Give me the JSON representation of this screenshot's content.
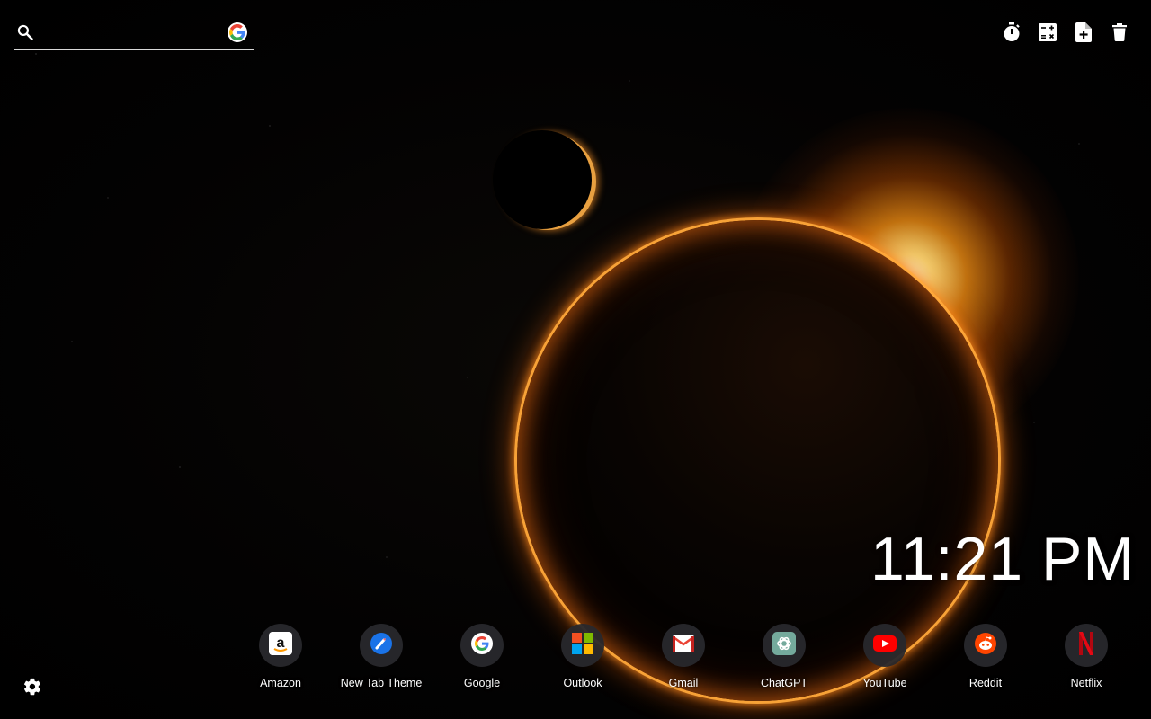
{
  "search": {
    "value": "",
    "placeholder": "",
    "engine_icon": "google-icon"
  },
  "toolbar": [
    {
      "icon": "stopwatch-icon"
    },
    {
      "icon": "calculator-icon"
    },
    {
      "icon": "add-note-icon"
    },
    {
      "icon": "trash-icon"
    }
  ],
  "clock": {
    "time": "11:21 PM"
  },
  "shortcuts": [
    {
      "label": "Amazon",
      "icon": "amazon-icon"
    },
    {
      "label": "New Tab Theme",
      "icon": "new-tab-theme-icon"
    },
    {
      "label": "Google",
      "icon": "google-icon"
    },
    {
      "label": "Outlook",
      "icon": "microsoft-icon"
    },
    {
      "label": "Gmail",
      "icon": "gmail-icon"
    },
    {
      "label": "ChatGPT",
      "icon": "chatgpt-icon"
    },
    {
      "label": "YouTube",
      "icon": "youtube-icon"
    },
    {
      "label": "Reddit",
      "icon": "reddit-icon"
    },
    {
      "label": "Netflix",
      "icon": "netflix-icon"
    }
  ],
  "settings": {
    "icon": "gear-icon"
  },
  "colors": {
    "amazon": "#ffffff",
    "new_tab_theme": "#1a73e8",
    "youtube": "#ff0000",
    "reddit": "#ff4500",
    "netflix": "#e50914",
    "chatgpt": "#74aa9c",
    "gmail": "#ea4335"
  }
}
